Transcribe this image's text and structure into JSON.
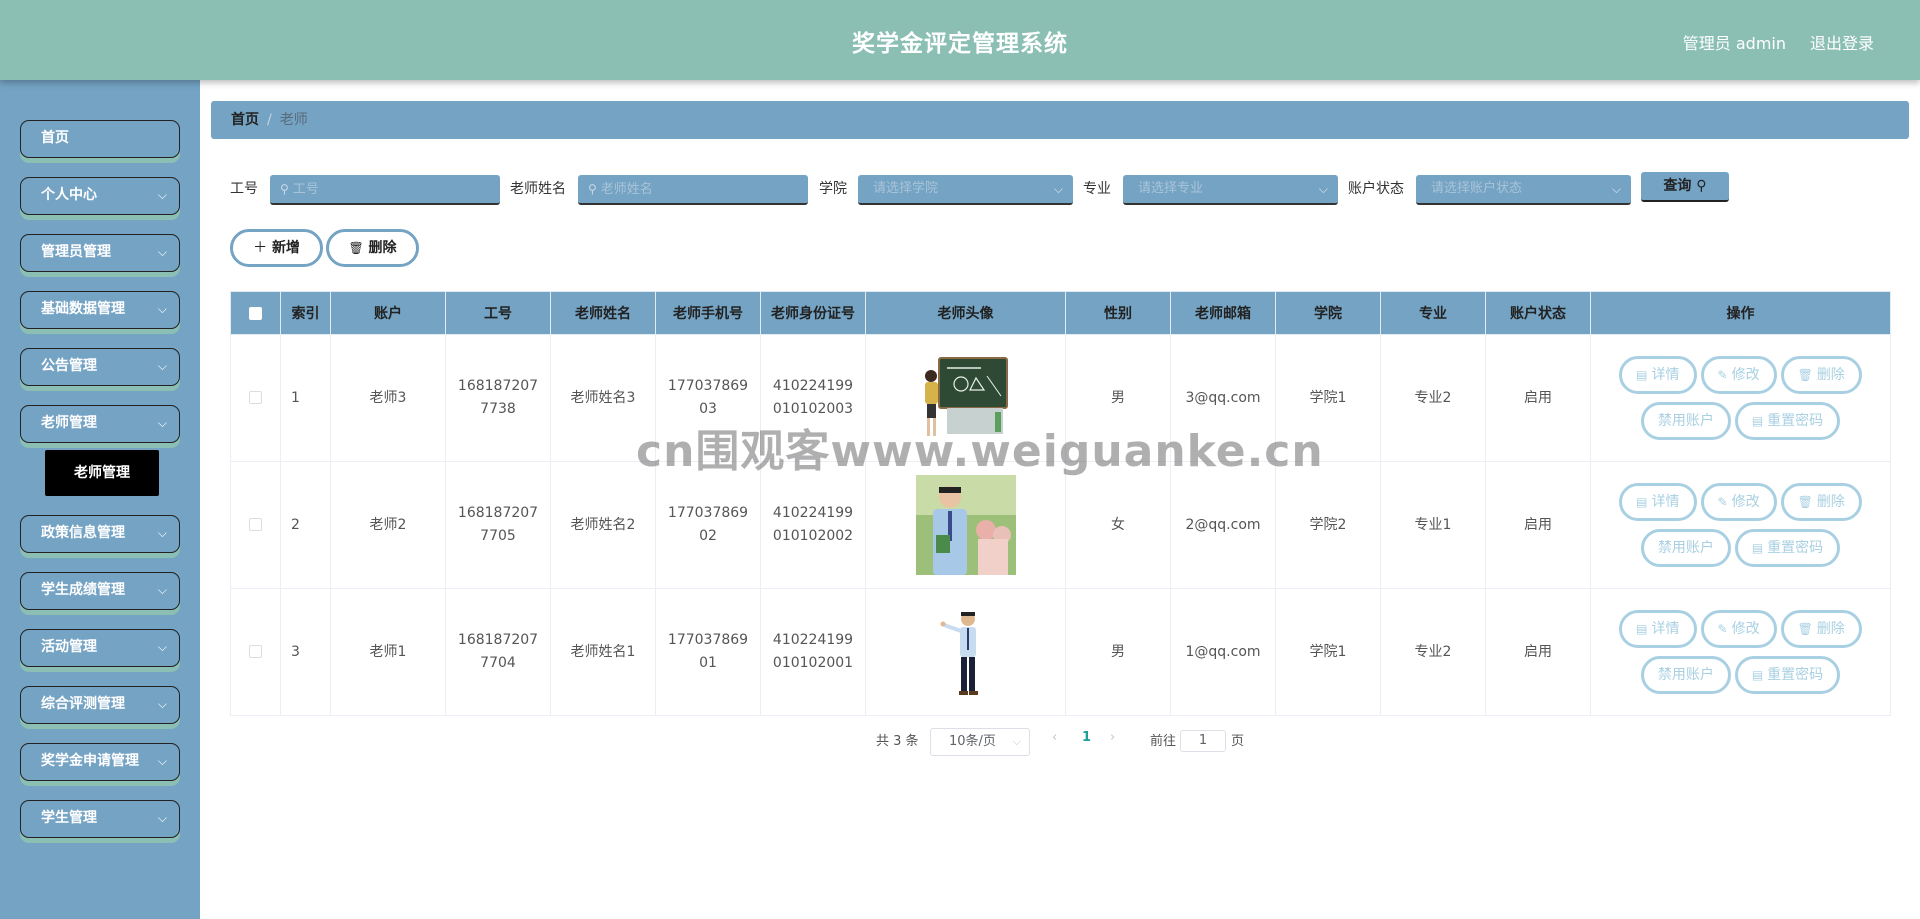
{
  "header": {
    "title": "奖学金评定管理系统",
    "user": "管理员 admin",
    "logout": "退出登录"
  },
  "sidebar": {
    "items": [
      {
        "label": "首页",
        "has_children": false
      },
      {
        "label": "个人中心",
        "has_children": true
      },
      {
        "label": "管理员管理",
        "has_children": true
      },
      {
        "label": "基础数据管理",
        "has_children": true
      },
      {
        "label": "公告管理",
        "has_children": true
      },
      {
        "label": "老师管理",
        "has_children": true
      },
      {
        "label": "政策信息管理",
        "has_children": true
      },
      {
        "label": "学生成绩管理",
        "has_children": true
      },
      {
        "label": "活动管理",
        "has_children": true
      },
      {
        "label": "综合评测管理",
        "has_children": true
      },
      {
        "label": "奖学金申请管理",
        "has_children": true
      },
      {
        "label": "学生管理",
        "has_children": true
      }
    ],
    "active_submenu": "老师管理"
  },
  "breadcrumb": {
    "home": "首页",
    "separator": "/",
    "current": "老师"
  },
  "search": {
    "fields": [
      {
        "label": "工号",
        "placeholder": "工号",
        "type": "text"
      },
      {
        "label": "老师姓名",
        "placeholder": "老师姓名",
        "type": "text"
      },
      {
        "label": "学院",
        "placeholder": "请选择学院",
        "type": "select"
      },
      {
        "label": "专业",
        "placeholder": "请选择专业",
        "type": "select"
      },
      {
        "label": "账户状态",
        "placeholder": "请选择账户状态",
        "type": "select"
      }
    ],
    "query_label": "查询"
  },
  "actions": {
    "add": "新增",
    "delete": "删除"
  },
  "table": {
    "columns": [
      "索引",
      "账户",
      "工号",
      "老师姓名",
      "老师手机号",
      "老师身份证号",
      "老师头像",
      "性别",
      "老师邮箱",
      "学院",
      "专业",
      "账户状态",
      "操作"
    ],
    "rows": [
      {
        "index": "1",
        "account": "老师3",
        "work_no": "1681872077738",
        "name": "老师姓名3",
        "phone": "17703786903",
        "id_card": "410224199010102003",
        "avatar": "teacher-at-blackboard",
        "gender": "男",
        "email": "3@qq.com",
        "college": "学院1",
        "major": "专业2",
        "status": "启用"
      },
      {
        "index": "2",
        "account": "老师2",
        "work_no": "1681872077705",
        "name": "老师姓名2",
        "phone": "17703786902",
        "id_card": "410224199010102002",
        "avatar": "teacher-outdoor-photo",
        "gender": "女",
        "email": "2@qq.com",
        "college": "学院2",
        "major": "专业1",
        "status": "启用"
      },
      {
        "index": "3",
        "account": "老师1",
        "work_no": "1681872077704",
        "name": "老师姓名1",
        "phone": "17703786901",
        "id_card": "410224199010102001",
        "avatar": "teacher-presenting",
        "gender": "男",
        "email": "1@qq.com",
        "college": "学院1",
        "major": "专业2",
        "status": "启用"
      }
    ],
    "row_actions": {
      "detail": "详情",
      "edit": "修改",
      "delete": "删除",
      "disable": "禁用账户",
      "reset": "重置密码"
    }
  },
  "pagination": {
    "total": "共 3 条",
    "page_size": "10条/页",
    "current_page": "1",
    "goto_label": "前往",
    "goto_value": "1",
    "page_unit": "页"
  },
  "watermark": "cn围观客www.weiguanke.cn",
  "colors": {
    "header": "#8bbfb4",
    "sidebar": "#74a3c4",
    "accent": "#74a3c4",
    "op_button": "#a8d0e2",
    "active_page": "#1aa094"
  }
}
